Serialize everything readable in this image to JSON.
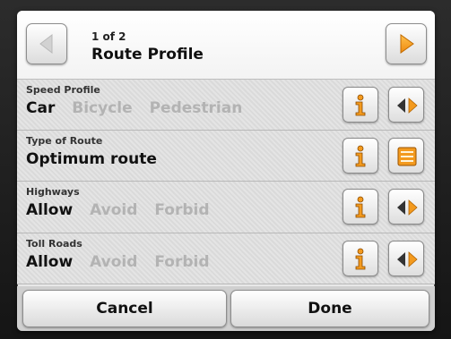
{
  "header": {
    "page_indicator": "1 of 2",
    "title": "Route Profile",
    "prev_icon": "chevron-left-icon",
    "next_icon": "chevron-right-icon"
  },
  "settings": [
    {
      "label": "Speed Profile",
      "options": [
        {
          "text": "Car",
          "selected": true
        },
        {
          "text": "Bicycle",
          "selected": false
        },
        {
          "text": "Pedestrian",
          "selected": false
        }
      ],
      "action_icon": "cycle-options-icon"
    },
    {
      "label": "Type of Route",
      "options": [
        {
          "text": "Optimum route",
          "selected": true
        }
      ],
      "action_icon": "list-icon"
    },
    {
      "label": "Highways",
      "options": [
        {
          "text": "Allow",
          "selected": true
        },
        {
          "text": "Avoid",
          "selected": false
        },
        {
          "text": "Forbid",
          "selected": false
        }
      ],
      "action_icon": "cycle-options-icon"
    },
    {
      "label": "Toll Roads",
      "options": [
        {
          "text": "Allow",
          "selected": true
        },
        {
          "text": "Avoid",
          "selected": false
        },
        {
          "text": "Forbid",
          "selected": false
        }
      ],
      "action_icon": "cycle-options-icon"
    }
  ],
  "info_icon": "info-icon",
  "footer": {
    "cancel_label": "Cancel",
    "done_label": "Done"
  },
  "colors": {
    "accent_orange": "#f39a1e",
    "selected_text": "#111111",
    "unselected_text": "#b3b3b3"
  }
}
